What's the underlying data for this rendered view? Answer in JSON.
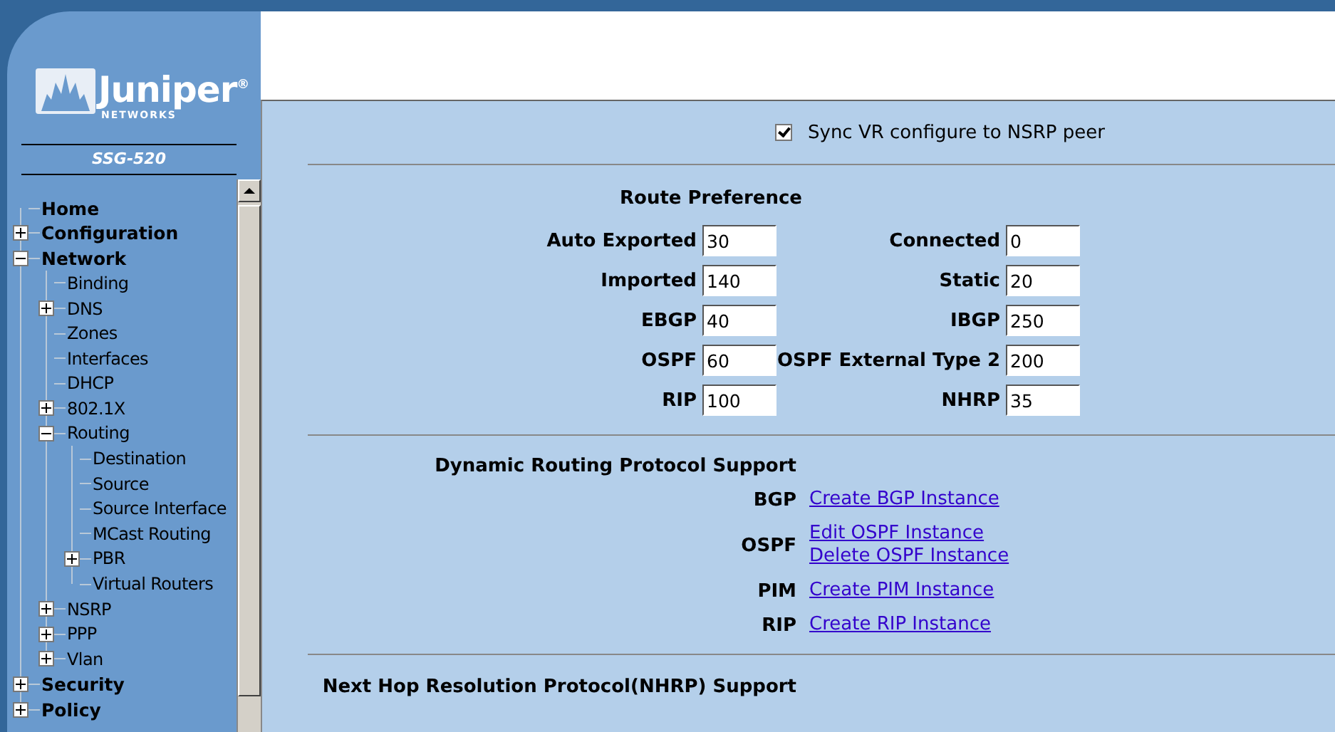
{
  "sidebar": {
    "logo": {
      "name": "Juniper$^{®}$",
      "sub": "NETWORKS"
    },
    "product": "SSG-520",
    "tree": [
      {
        "label": "Home"
      },
      {
        "label": "Configuration",
        "expanded": false
      },
      {
        "label": "Network",
        "expanded": true,
        "children": [
          {
            "label": "Binding"
          },
          {
            "label": "DNS",
            "expanded": false
          },
          {
            "label": "Zones"
          },
          {
            "label": "Interfaces"
          },
          {
            "label": "DHCP"
          },
          {
            "label": "802.1X",
            "expanded": false
          },
          {
            "label": "Routing",
            "expanded": true,
            "children": [
              {
                "label": "Destination"
              },
              {
                "label": "Source"
              },
              {
                "label": "Source Interface"
              },
              {
                "label": "MCast Routing"
              },
              {
                "label": "PBR",
                "expanded": false
              },
              {
                "label": "Virtual Routers"
              }
            ]
          },
          {
            "label": "NSRP",
            "expanded": false
          },
          {
            "label": "PPP",
            "expanded": false
          },
          {
            "label": "Vlan",
            "expanded": false
          }
        ]
      },
      {
        "label": "Security",
        "expanded": false
      },
      {
        "label": "Policy",
        "expanded": false
      }
    ]
  },
  "sync": {
    "label": "Sync VR configure to NSRP peer",
    "checked": true
  },
  "route_preference": {
    "title": "Route Preference",
    "fields": [
      {
        "label": "Auto Exported",
        "value": "30"
      },
      {
        "label": "Connected",
        "value": "0"
      },
      {
        "label": "Imported",
        "value": "140"
      },
      {
        "label": "Static",
        "value": "20"
      },
      {
        "label": "EBGP",
        "value": "40"
      },
      {
        "label": "IBGP",
        "value": "250"
      },
      {
        "label": "OSPF",
        "value": "60"
      },
      {
        "label": "OSPF External Type 2",
        "value": "200"
      },
      {
        "label": "RIP",
        "value": "100"
      },
      {
        "label": "NHRP",
        "value": "35"
      }
    ]
  },
  "dynamic_routing": {
    "title": "Dynamic Routing Protocol Support",
    "protocols": [
      {
        "name": "BGP",
        "links": [
          "Create BGP Instance"
        ]
      },
      {
        "name": "OSPF",
        "links": [
          "Edit OSPF Instance",
          "Delete OSPF Instance"
        ]
      },
      {
        "name": "PIM",
        "links": [
          "Create PIM Instance"
        ]
      },
      {
        "name": "RIP",
        "links": [
          "Create RIP Instance"
        ]
      }
    ]
  },
  "nhrp": {
    "title": "Next Hop Resolution Protocol(NHRP) Support"
  }
}
